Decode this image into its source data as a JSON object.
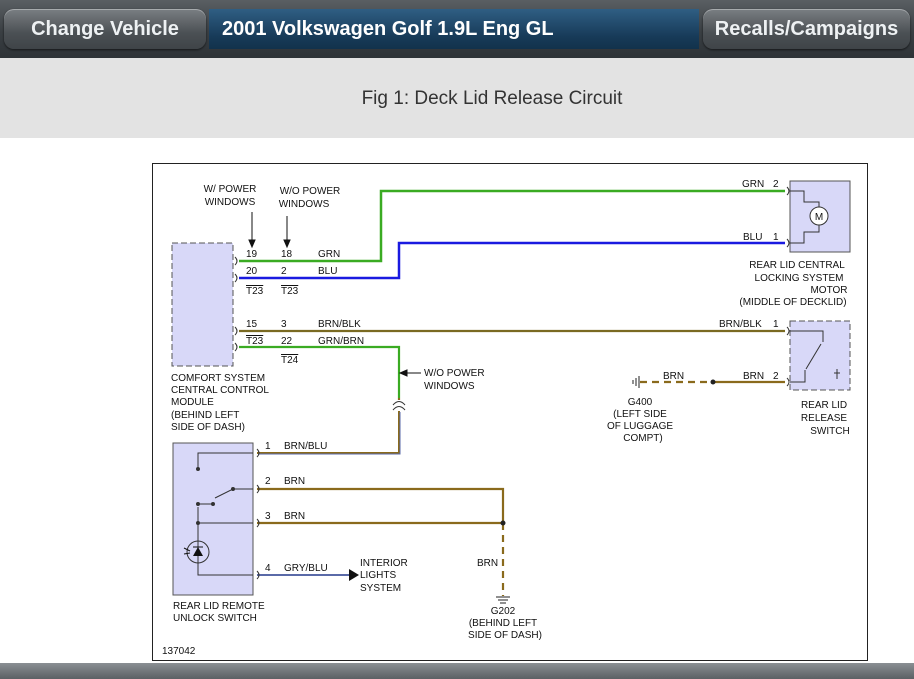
{
  "header": {
    "change_vehicle": "Change Vehicle",
    "vehicle_title": "2001 Volkswagen Golf 1.9L Eng GL",
    "recalls": "Recalls/Campaigns"
  },
  "figure": {
    "title": "Fig 1: Deck Lid Release Circuit"
  },
  "diagram": {
    "id_number": "137042",
    "labels": {
      "w_power": "W/ POWER",
      "windows_a": "WINDOWS",
      "wo_power": "W/O POWER",
      "windows_b": "WINDOWS",
      "wo_power_2": "W/O POWER",
      "windows_c": "WINDOWS"
    },
    "comfort_module": [
      "COMFORT SYSTEM",
      "CENTRAL CONTROL",
      "MODULE",
      "(BEHIND LEFT",
      "SIDE OF DASH)"
    ],
    "motor": [
      "REAR LID CENTRAL",
      "LOCKING SYSTEM",
      "MOTOR",
      "(MIDDLE OF DECKLID)"
    ],
    "motor_symbol": "M",
    "release_switch": [
      "REAR LID",
      "RELEASE",
      "SWITCH"
    ],
    "remote_switch": [
      "REAR LID REMOTE",
      "UNLOCK SWITCH"
    ],
    "interior_lights": [
      "INTERIOR",
      "LIGHTS",
      "SYSTEM"
    ],
    "g400": [
      "G400",
      "(LEFT SIDE",
      "OF LUGGAGE",
      "COMPT)"
    ],
    "g202": [
      "G202",
      "(BEHIND LEFT",
      "SIDE OF DASH)"
    ],
    "pins": {
      "p19": "19",
      "p18": "18",
      "p20": "20",
      "p2": "2",
      "p15": "15",
      "p3": "3",
      "p22": "22",
      "t23a": "T23",
      "t23b": "T23",
      "t23c": "T23",
      "t24": "T24",
      "motor_2": "2",
      "motor_1": "1",
      "sw_1": "1",
      "sw_2": "2",
      "rs_1": "1",
      "rs_2": "2",
      "rs_3": "3",
      "rs_4": "4"
    },
    "wires": {
      "grn": "GRN",
      "blu": "BLU",
      "brn_blk": "BRN/BLK",
      "grn_brn": "GRN/BRN",
      "grn_motor": "GRN",
      "blu_motor": "BLU",
      "brn_blk_sw": "BRN/BLK",
      "brn_g400": "BRN",
      "brn_sw2": "BRN",
      "brn_blu": "BRN/BLU",
      "brn_2": "BRN",
      "brn_3": "BRN",
      "gry_blu": "GRY/BLU",
      "brn_g202": "BRN"
    },
    "colors": {
      "green": "#3aab22",
      "blue": "#1a1ae0",
      "brown": "#8a6a1c",
      "olive": "#7a6a22",
      "gray_blue": "#5a6aa8",
      "component_fill": "#d8d8f8"
    }
  }
}
